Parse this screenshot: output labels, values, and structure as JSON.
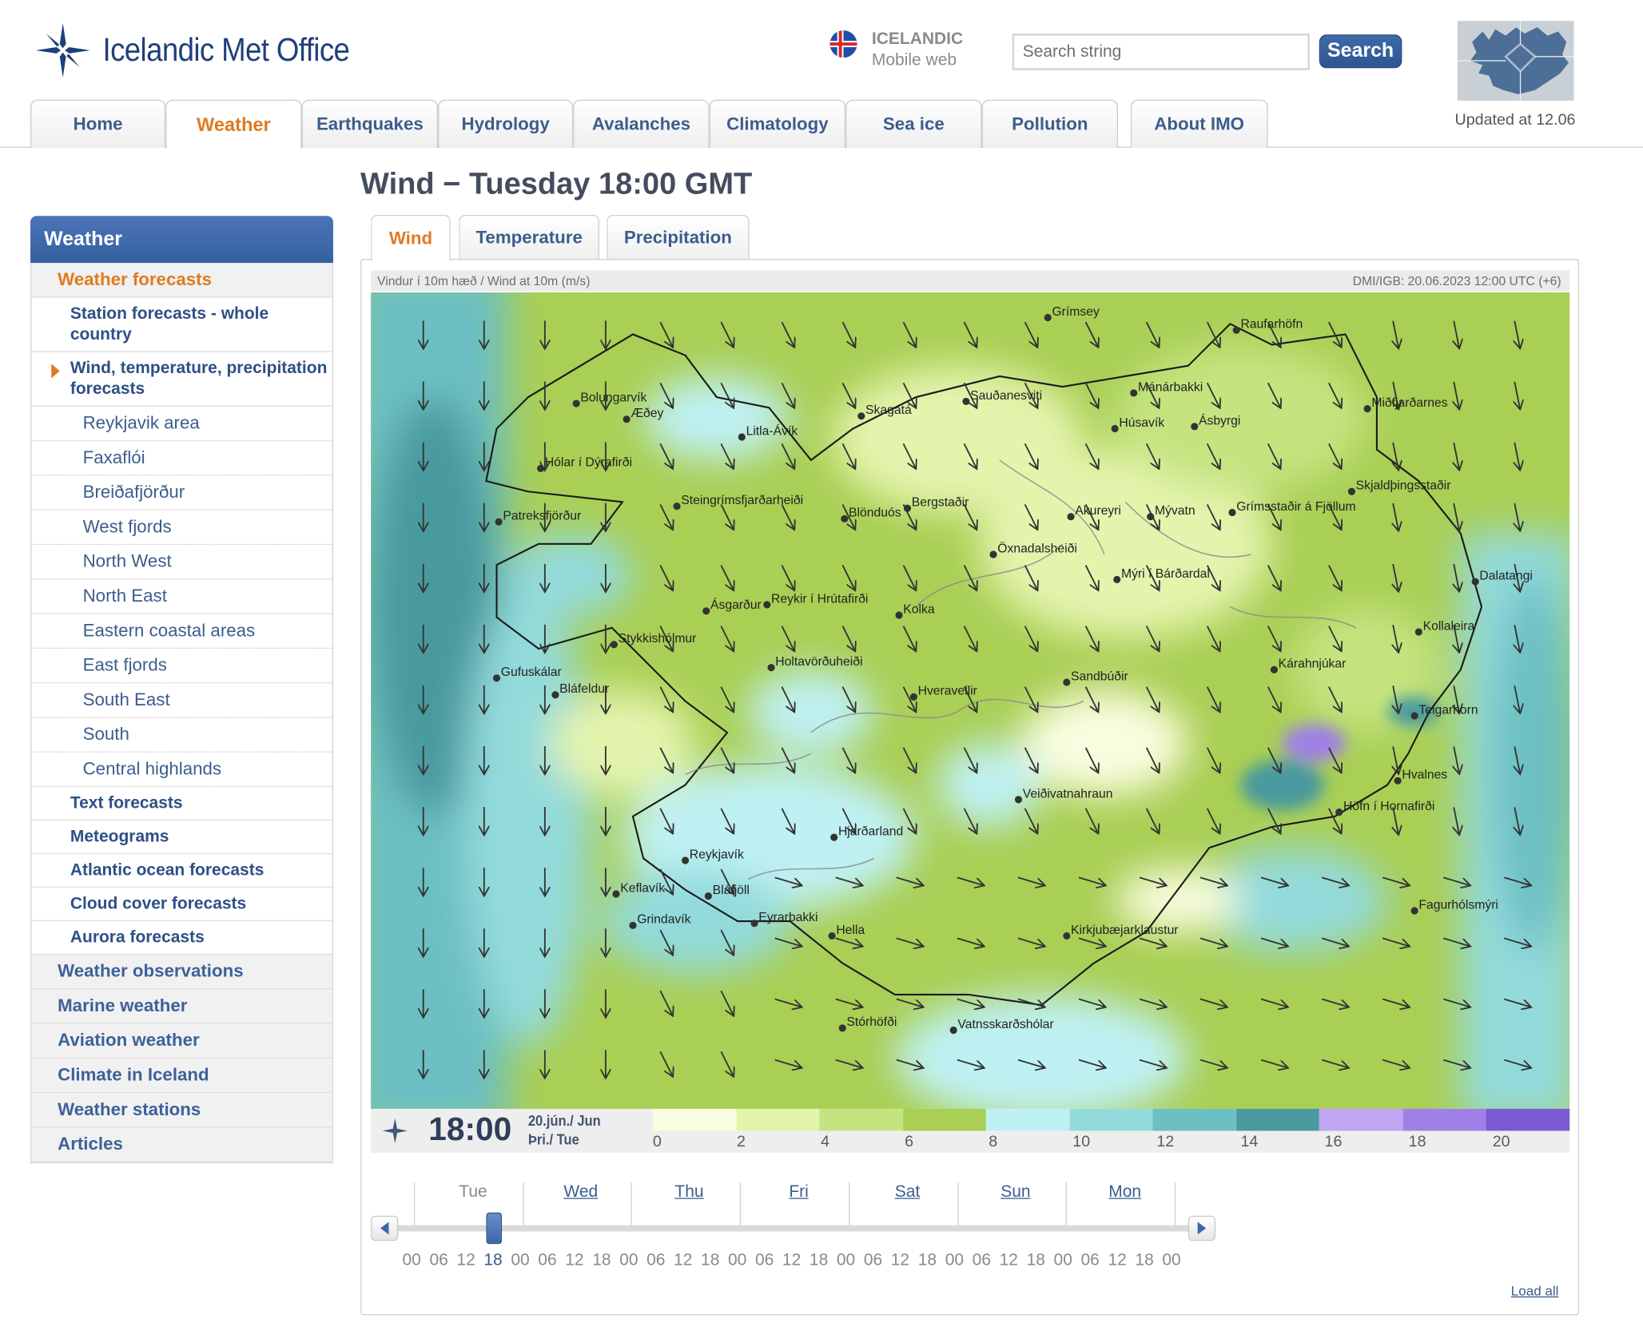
{
  "header": {
    "logo_text": "Icelandic Met Office",
    "lang_title": "ICELANDIC",
    "lang_sub": "Mobile web",
    "search_placeholder": "Search string",
    "search_button": "Search",
    "updated": "Updated at 12.06"
  },
  "nav": {
    "tabs": [
      {
        "label": "Home"
      },
      {
        "label": "Weather"
      },
      {
        "label": "Earthquakes"
      },
      {
        "label": "Hydrology"
      },
      {
        "label": "Avalanches"
      },
      {
        "label": "Climatology"
      },
      {
        "label": "Sea ice"
      },
      {
        "label": "Pollution"
      },
      {
        "label": "About IMO"
      }
    ],
    "active": "Weather"
  },
  "sidebar": {
    "title": "Weather",
    "items": [
      {
        "label": "Weather forecasts"
      },
      {
        "label": "Station forecasts - whole country"
      },
      {
        "label": "Wind, temperature, precipitation forecasts"
      },
      {
        "label": "Reykjavik area"
      },
      {
        "label": "Faxaflói"
      },
      {
        "label": "Breiðafjörður"
      },
      {
        "label": "West fjords"
      },
      {
        "label": "North West"
      },
      {
        "label": "North East"
      },
      {
        "label": "Eastern coastal areas"
      },
      {
        "label": "East fjords"
      },
      {
        "label": "South East"
      },
      {
        "label": "South"
      },
      {
        "label": "Central highlands"
      },
      {
        "label": "Text forecasts"
      },
      {
        "label": "Meteograms"
      },
      {
        "label": "Atlantic ocean forecasts"
      },
      {
        "label": "Cloud cover forecasts"
      },
      {
        "label": "Aurora forecasts"
      },
      {
        "label": "Weather observations"
      },
      {
        "label": "Marine weather"
      },
      {
        "label": "Aviation weather"
      },
      {
        "label": "Climate in Iceland"
      },
      {
        "label": "Weather stations"
      },
      {
        "label": "Articles"
      }
    ]
  },
  "main": {
    "title": "Wind − Tuesday 18:00 GMT",
    "tabs": [
      {
        "label": "Wind"
      },
      {
        "label": "Temperature"
      },
      {
        "label": "Precipitation"
      }
    ],
    "map_caption_left": "Vindur í 10m hæð / Wind at 10m (m/s)",
    "map_caption_right": "DMI/IGB: 20.06.2023 12:00 UTC (+6)",
    "map_labels": [
      {
        "name": "Grímsey"
      },
      {
        "name": "Raufarhöfn"
      },
      {
        "name": "Bolungarvík"
      },
      {
        "name": "Æðey"
      },
      {
        "name": "Litla-Ávík"
      },
      {
        "name": "Skagatá"
      },
      {
        "name": "Sauðanesviti"
      },
      {
        "name": "Mánárbakki"
      },
      {
        "name": "Húsavík"
      },
      {
        "name": "Ásbyrgi"
      },
      {
        "name": "Miðfjarðarnes"
      },
      {
        "name": "Hólar í Dýrafirði"
      },
      {
        "name": "Steingrímsfjarðarheiði"
      },
      {
        "name": "Patreksfjörður"
      },
      {
        "name": "Blönduós"
      },
      {
        "name": "Bergstaðir"
      },
      {
        "name": "Akureyri"
      },
      {
        "name": "Mývatn"
      },
      {
        "name": "Grímsstaðir á Fjöllum"
      },
      {
        "name": "Skjaldþingsstaðir"
      },
      {
        "name": "Öxnadalsheiði"
      },
      {
        "name": "Mýri í Bárðardal"
      },
      {
        "name": "Dalatangi"
      },
      {
        "name": "Ásgarður"
      },
      {
        "name": "Reykir í Hrútafirði"
      },
      {
        "name": "Kolka"
      },
      {
        "name": "Kollaleira"
      },
      {
        "name": "Stykkishólmur"
      },
      {
        "name": "Gufuskálar"
      },
      {
        "name": "Bláfeldur"
      },
      {
        "name": "Holtavörðuheiði"
      },
      {
        "name": "Sandbúðir"
      },
      {
        "name": "Kárahnjúkar"
      },
      {
        "name": "Hveravellir"
      },
      {
        "name": "Teigarhorn"
      },
      {
        "name": "Hvalnes"
      },
      {
        "name": "Veiðivatnahraun"
      },
      {
        "name": "Höfn í Hornafirði"
      },
      {
        "name": "Hjarðarland"
      },
      {
        "name": "Reykjavík"
      },
      {
        "name": "Keflavík"
      },
      {
        "name": "Bláfjöll"
      },
      {
        "name": "Grindavík"
      },
      {
        "name": "Eyrarbakki"
      },
      {
        "name": "Fagurhólsmýri"
      },
      {
        "name": "Hella"
      },
      {
        "name": "Kirkjubæjarklaustur"
      },
      {
        "name": "Stórhöfði"
      },
      {
        "name": "Vatnsskarðshólar"
      }
    ],
    "legend_time": "18:00",
    "legend_date_1": "20.jún./ Jun",
    "legend_date_2": "Þri./ Tue",
    "legend_scale_colors": [
      "#fafde0",
      "#e4f4ad",
      "#c5e480",
      "#a9cf55",
      "#bff1f4",
      "#93dadb",
      "#6cbfc2",
      "#4a9a9f",
      "#c0a6f2",
      "#9f80e6",
      "#7b5bd3"
    ],
    "legend_ticks": [
      "0",
      "2",
      "4",
      "6",
      "8",
      "10",
      "12",
      "14",
      "16",
      "18",
      "20"
    ],
    "timeline_days": [
      {
        "label": "Tue"
      },
      {
        "label": "Wed"
      },
      {
        "label": "Thu"
      },
      {
        "label": "Fri"
      },
      {
        "label": "Sat"
      },
      {
        "label": "Sun"
      },
      {
        "label": "Mon"
      }
    ],
    "timeline_hours": [
      "00",
      "06",
      "12",
      "18",
      "00",
      "06",
      "12",
      "18",
      "00",
      "06",
      "12",
      "18",
      "00",
      "06",
      "12",
      "18",
      "00",
      "06",
      "12",
      "18",
      "00",
      "06",
      "12",
      "18",
      "00",
      "06",
      "12",
      "18",
      "00"
    ],
    "timeline_selected_index": 3,
    "load_all": "Load all"
  },
  "colors": {
    "accent_orange": "#e07a20",
    "link_blue": "#3c5d8c",
    "sidebar_header": "#3e69ad"
  }
}
